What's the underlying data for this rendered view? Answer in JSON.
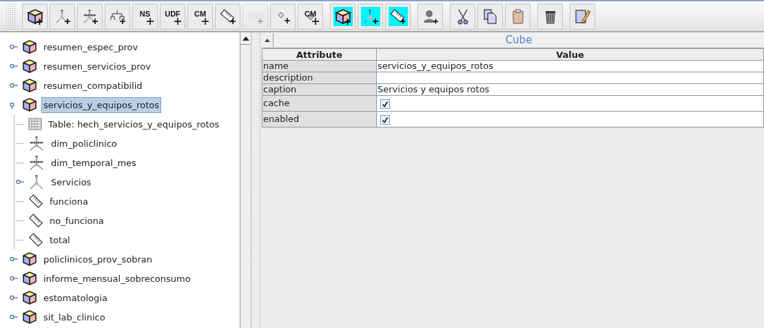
{
  "toolbar": [
    [
      {
        "kind": "cube",
        "active": false,
        "disabled": false
      },
      {
        "kind": "dimension",
        "active": false,
        "disabled": false
      },
      {
        "kind": "dimension-levels",
        "active": false,
        "disabled": false
      },
      {
        "kind": "hierarchy",
        "active": false,
        "disabled": false
      },
      {
        "kind": "text",
        "label": "NS",
        "active": false,
        "disabled": false
      },
      {
        "kind": "text",
        "label": "UDF",
        "active": false,
        "disabled": false
      },
      {
        "kind": "text",
        "label": "CM",
        "active": false,
        "disabled": false
      },
      {
        "kind": "measure",
        "active": false,
        "disabled": false
      },
      {
        "kind": "levels",
        "active": false,
        "disabled": true
      },
      {
        "kind": "property",
        "active": false,
        "disabled": false
      },
      {
        "kind": "text-diamond",
        "label": "CM",
        "active": false,
        "disabled": false
      }
    ],
    [
      {
        "kind": "cube",
        "active": true,
        "disabled": false
      },
      {
        "kind": "dimension",
        "active": true,
        "disabled": false
      },
      {
        "kind": "measure",
        "active": true,
        "disabled": false
      }
    ],
    [
      {
        "kind": "user",
        "active": false,
        "disabled": false
      }
    ],
    [
      {
        "kind": "cut",
        "active": false,
        "disabled": false
      },
      {
        "kind": "copy",
        "active": false,
        "disabled": false
      },
      {
        "kind": "paste",
        "active": false,
        "disabled": false
      }
    ],
    [
      {
        "kind": "delete",
        "active": false,
        "disabled": false
      }
    ],
    [
      {
        "kind": "edit",
        "active": false,
        "disabled": false
      }
    ]
  ],
  "tree": [
    {
      "label": "resumen_espec_prov",
      "kind": "cube",
      "expanded": false,
      "selected": false
    },
    {
      "label": "resumen_servicios_prov",
      "kind": "cube",
      "expanded": false,
      "selected": false
    },
    {
      "label": "resumen_compatibilid",
      "kind": "cube",
      "expanded": false,
      "selected": false
    },
    {
      "label": "servicios_y_equipos_rotos",
      "kind": "cube",
      "expanded": true,
      "selected": true,
      "children": [
        {
          "label": "Table: hech_servicios_y_equipos_rotos",
          "kind": "table",
          "selected": false
        },
        {
          "label": "dim_policlinico",
          "kind": "dimension",
          "selected": false
        },
        {
          "label": "dim_temporal_mes",
          "kind": "dimension",
          "selected": false
        },
        {
          "label": "Servicios",
          "kind": "hierarchy",
          "expanded": false,
          "selected": false
        },
        {
          "label": "funciona",
          "kind": "measure",
          "selected": false
        },
        {
          "label": "no_funciona",
          "kind": "measure",
          "selected": false
        },
        {
          "label": "total",
          "kind": "measure",
          "selected": false
        }
      ]
    },
    {
      "label": "policlinicos_prov_sobran",
      "kind": "cube",
      "expanded": false,
      "selected": false
    },
    {
      "label": "informe_mensual_sobreconsumo",
      "kind": "cube",
      "expanded": false,
      "selected": false
    },
    {
      "label": "estomatologia",
      "kind": "cube",
      "expanded": false,
      "selected": false
    },
    {
      "label": "sit_lab_clinico",
      "kind": "cube",
      "expanded": false,
      "selected": false
    }
  ],
  "properties": {
    "title": "Cube",
    "columns": [
      "Attribute",
      "Value"
    ],
    "rows": [
      {
        "attribute": "name",
        "kind": "text",
        "value": "servicios_y_equipos_rotos"
      },
      {
        "attribute": "description",
        "kind": "text"
      },
      {
        "attribute": "caption",
        "kind": "text",
        "value": "Servicios y equipos rotos"
      },
      {
        "attribute": "cache",
        "kind": "checkbox",
        "checked": true
      },
      {
        "attribute": "enabled",
        "kind": "checkbox",
        "checked": true
      }
    ]
  }
}
